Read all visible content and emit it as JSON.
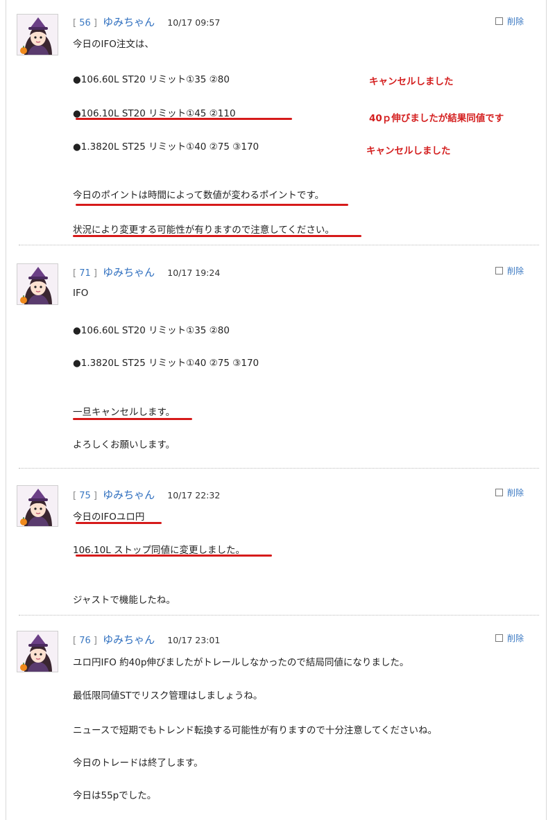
{
  "delete_label": "削除",
  "posts": [
    {
      "number": "56",
      "name": "ゆみちゃん",
      "time": "10/17 09:57",
      "lines": [
        "今日のIFO注文は、",
        "●106.60L ST20 リミット①35 ②80",
        "●106.10L ST20 リミット①45 ②110",
        "●1.3820L ST25 リミット①40 ②75 ③170",
        "今日のポイントは時間によって数値が変わるポイントです。",
        "状況により変更する可能性が有りますので注意してください。"
      ],
      "notes": [
        "キャンセルしました",
        "40ｐ伸びましたが結果同値です",
        "キャンセルしました"
      ]
    },
    {
      "number": "71",
      "name": "ゆみちゃん",
      "time": "10/17 19:24",
      "lines": [
        "IFO",
        "●106.60L ST20 リミット①35 ②80",
        "●1.3820L ST25 リミット①40 ②75 ③170",
        "一旦キャンセルします。",
        "よろしくお願いします。"
      ]
    },
    {
      "number": "75",
      "name": "ゆみちゃん",
      "time": "10/17 22:32",
      "lines": [
        "今日のIFOユロ円",
        "106.10L ストップ同値に変更しました。",
        "ジャストで機能したね。"
      ]
    },
    {
      "number": "76",
      "name": "ゆみちゃん",
      "time": "10/17 23:01",
      "lines": [
        "ユロ円IFO 約40p伸びましたがトレールしなかったので結局同値になりました。",
        "最低限同値STでリスク管理はしましょうね。",
        "ニュースで短期でもトレンド転換する可能性が有りますので十分注意してくださいね。",
        "今日のトレードは終了します。",
        "今日は55pでした。"
      ]
    }
  ]
}
